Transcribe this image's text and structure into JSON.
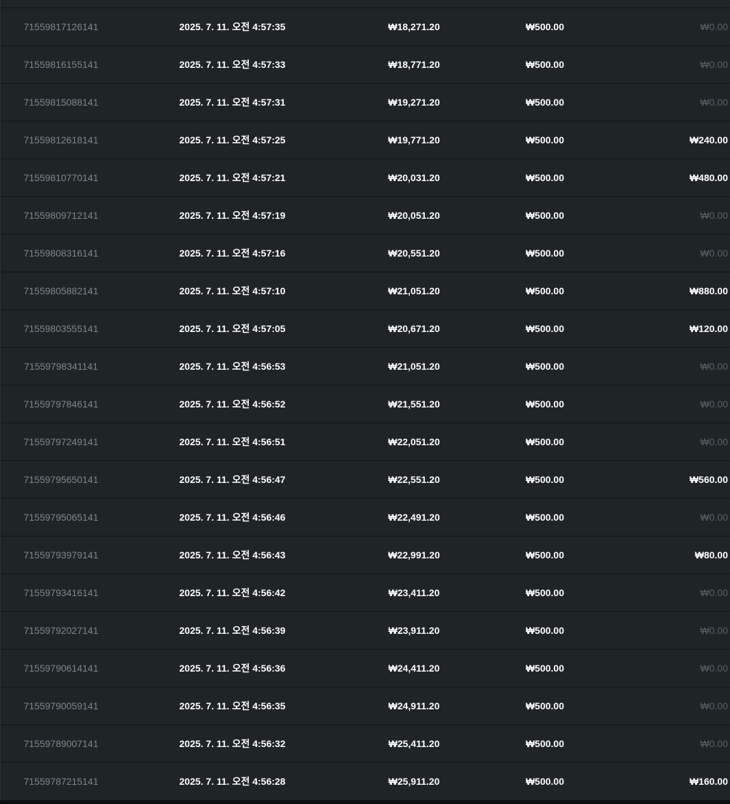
{
  "rows": [
    {
      "id": "71559817126141",
      "time": "2025. 7. 11. 오전 4:57:35",
      "balance": "₩18,271.20",
      "bet": "₩500.00",
      "win": "₩0.00",
      "win_zero": true
    },
    {
      "id": "71559816155141",
      "time": "2025. 7. 11. 오전 4:57:33",
      "balance": "₩18,771.20",
      "bet": "₩500.00",
      "win": "₩0.00",
      "win_zero": true
    },
    {
      "id": "71559815088141",
      "time": "2025. 7. 11. 오전 4:57:31",
      "balance": "₩19,271.20",
      "bet": "₩500.00",
      "win": "₩0.00",
      "win_zero": true
    },
    {
      "id": "71559812618141",
      "time": "2025. 7. 11. 오전 4:57:25",
      "balance": "₩19,771.20",
      "bet": "₩500.00",
      "win": "₩240.00",
      "win_zero": false
    },
    {
      "id": "71559810770141",
      "time": "2025. 7. 11. 오전 4:57:21",
      "balance": "₩20,031.20",
      "bet": "₩500.00",
      "win": "₩480.00",
      "win_zero": false
    },
    {
      "id": "71559809712141",
      "time": "2025. 7. 11. 오전 4:57:19",
      "balance": "₩20,051.20",
      "bet": "₩500.00",
      "win": "₩0.00",
      "win_zero": true
    },
    {
      "id": "71559808316141",
      "time": "2025. 7. 11. 오전 4:57:16",
      "balance": "₩20,551.20",
      "bet": "₩500.00",
      "win": "₩0.00",
      "win_zero": true
    },
    {
      "id": "71559805882141",
      "time": "2025. 7. 11. 오전 4:57:10",
      "balance": "₩21,051.20",
      "bet": "₩500.00",
      "win": "₩880.00",
      "win_zero": false
    },
    {
      "id": "71559803555141",
      "time": "2025. 7. 11. 오전 4:57:05",
      "balance": "₩20,671.20",
      "bet": "₩500.00",
      "win": "₩120.00",
      "win_zero": false
    },
    {
      "id": "71559798341141",
      "time": "2025. 7. 11. 오전 4:56:53",
      "balance": "₩21,051.20",
      "bet": "₩500.00",
      "win": "₩0.00",
      "win_zero": true
    },
    {
      "id": "71559797846141",
      "time": "2025. 7. 11. 오전 4:56:52",
      "balance": "₩21,551.20",
      "bet": "₩500.00",
      "win": "₩0.00",
      "win_zero": true
    },
    {
      "id": "71559797249141",
      "time": "2025. 7. 11. 오전 4:56:51",
      "balance": "₩22,051.20",
      "bet": "₩500.00",
      "win": "₩0.00",
      "win_zero": true
    },
    {
      "id": "71559795650141",
      "time": "2025. 7. 11. 오전 4:56:47",
      "balance": "₩22,551.20",
      "bet": "₩500.00",
      "win": "₩560.00",
      "win_zero": false
    },
    {
      "id": "71559795065141",
      "time": "2025. 7. 11. 오전 4:56:46",
      "balance": "₩22,491.20",
      "bet": "₩500.00",
      "win": "₩0.00",
      "win_zero": true
    },
    {
      "id": "71559793979141",
      "time": "2025. 7. 11. 오전 4:56:43",
      "balance": "₩22,991.20",
      "bet": "₩500.00",
      "win": "₩80.00",
      "win_zero": false
    },
    {
      "id": "71559793416141",
      "time": "2025. 7. 11. 오전 4:56:42",
      "balance": "₩23,411.20",
      "bet": "₩500.00",
      "win": "₩0.00",
      "win_zero": true
    },
    {
      "id": "71559792027141",
      "time": "2025. 7. 11. 오전 4:56:39",
      "balance": "₩23,911.20",
      "bet": "₩500.00",
      "win": "₩0.00",
      "win_zero": true
    },
    {
      "id": "71559790614141",
      "time": "2025. 7. 11. 오전 4:56:36",
      "balance": "₩24,411.20",
      "bet": "₩500.00",
      "win": "₩0.00",
      "win_zero": true
    },
    {
      "id": "71559790059141",
      "time": "2025. 7. 11. 오전 4:56:35",
      "balance": "₩24,911.20",
      "bet": "₩500.00",
      "win": "₩0.00",
      "win_zero": true
    },
    {
      "id": "71559789007141",
      "time": "2025. 7. 11. 오전 4:56:32",
      "balance": "₩25,411.20",
      "bet": "₩500.00",
      "win": "₩0.00",
      "win_zero": true
    },
    {
      "id": "71559787215141",
      "time": "2025. 7. 11. 오전 4:56:28",
      "balance": "₩25,911.20",
      "bet": "₩500.00",
      "win": "₩160.00",
      "win_zero": false
    }
  ]
}
